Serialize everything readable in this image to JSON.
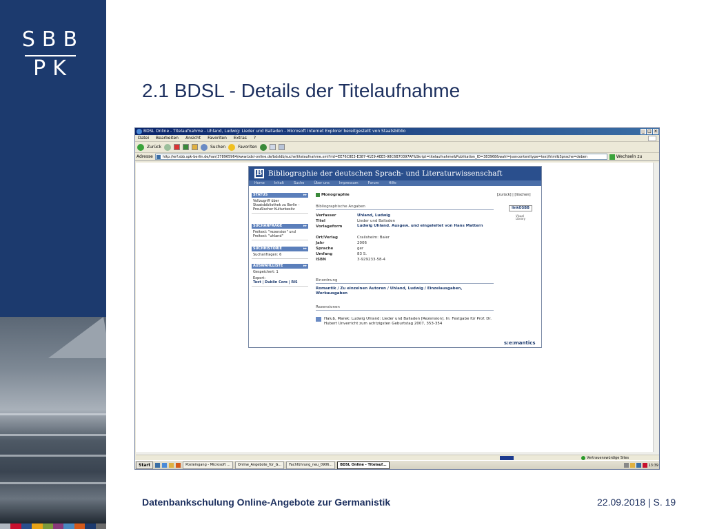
{
  "slide": {
    "logo_top": "SBB",
    "logo_bottom": "PK",
    "title": "2.1 BDSL - Details der Titelaufnahme",
    "footer_left": "Datenbankschulung Online-Angebote zur Germanistik",
    "footer_date": "22.09.2018",
    "footer_separator": "|",
    "footer_page": "S. 19",
    "colors": {
      "band": "#1c3a6e",
      "title": "#1c2f5e",
      "colorbar": [
        "#b0b7c0",
        "#c8102e",
        "#2a4f8d",
        "#e8a317",
        "#7b9a3c",
        "#8a3a7a",
        "#4a8ac0",
        "#d45a1a",
        "#1c3a6e",
        "#6a6a6a"
      ]
    }
  },
  "browser": {
    "window_title": "BDSL Online - Titelaufnahme - Uhland, Ludwig: Lieder und Balladen - Microsoft Internet Explorer bereitgestellt von Staatsbiblio",
    "menu": [
      "Datei",
      "Bearbeiten",
      "Ansicht",
      "Favoriten",
      "Extras",
      "?"
    ],
    "toolbar": {
      "back": "Zurück",
      "search": "Suchen",
      "favorites": "Favoriten"
    },
    "address_label": "Adresse",
    "url": "http://erf.sbb.spk-berlin.de/han/378965964/www.bdsl-online.de/bdsldb/suche/titelaufnahme.xml?rid=EE76C8E3-E387-41E9-AEE5-98C6B70397AF&Skript=titelaufnahme&Publikation_ID=383968&wahl=jsoncontenttype=text/html&Sprache=deben",
    "go_label": "Wechseln zu",
    "status_zone": "Vertrauenswürdige Sites",
    "taskbar": {
      "start": "Start",
      "tasks": [
        "Posteingang - Microsoft ...",
        "Online_Angebote_für_G...",
        "Fachführung_neu_0906...",
        "BDSL Online - Titelauf..."
      ],
      "clock": "13:39"
    }
  },
  "bdsl": {
    "header": "Bibliographie der deutschen Sprach- und Literaturwissenschaft",
    "nav": [
      "Home",
      "Inhalt",
      "Suche",
      "Über uns",
      "Impressum",
      "Forum",
      "Hilfe"
    ],
    "status": {
      "heading": "STATUS",
      "text": "Vollzugriff über Staatsbibliothek zu Berlin - Preußischer Kulturbesitz"
    },
    "suchanfrage": {
      "heading": "SUCHANFRAGE",
      "text": "Freitext: \"rezension\" und Freitext: \"uhland\""
    },
    "suchhistorie": {
      "heading": "SUCHHISTORIE",
      "text": "Suchanfragen: 6"
    },
    "auswahlliste": {
      "heading": "AUSWAHLLISTE",
      "saved": "Gespeichert: 1",
      "export_label": "Export:",
      "export_formats": "Text | Dublin Core | RIS"
    },
    "type": "Monographie",
    "zuruck": "[zurück] | [löschen]",
    "section_bib": "Bibliographische Angaben",
    "linko": "linkOSBB",
    "visual_library": "Visual Library",
    "fields": [
      {
        "key": "Verfasser",
        "value": "Uhland, Ludwig"
      },
      {
        "key": "Titel",
        "value": "Lieder und Balladen"
      },
      {
        "key": "Vorlageform",
        "value": "Ludwig Uhland. Ausgew. und eingeleitet von Hans Mattern"
      },
      {
        "key": "Ort/Verlag",
        "value": "Crailsheim: Baier"
      },
      {
        "key": "Jahr",
        "value": "2006"
      },
      {
        "key": "Sprache",
        "value": "ger"
      },
      {
        "key": "Umfang",
        "value": "83 S."
      },
      {
        "key": "ISBN",
        "value": "3-929233-58-4"
      }
    ],
    "section_einordnung": "Einordnung",
    "einordnung_link": "Romantik / Zu einzelnen Autoren / Uhland, Ludwig / Einzelausgaben, Werkausgaben",
    "section_rezensionen": "Rezensionen",
    "rezension": "Halub, Marek: Ludwig Uhland: Lieder und Balladen [Rezension]. In: Festgabe für Prof. Dr. Hubert Unverricht zum achtzigsten Geburtstag 2007, 353-354",
    "footer_brand": "s:e:mantics"
  }
}
